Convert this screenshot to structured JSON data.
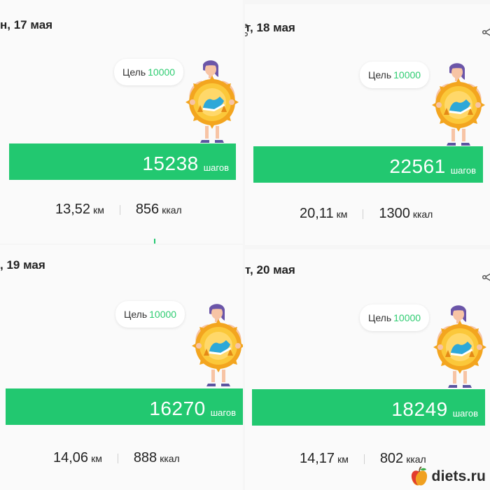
{
  "panels": [
    {
      "date": "н, 17 мая",
      "goal_label": "Цель",
      "goal_value": "10000",
      "steps": "15238",
      "steps_unit": "шагов",
      "distance": "13,52",
      "distance_unit": "км",
      "calories": "856",
      "calories_unit": "ккал"
    },
    {
      "date": "т, 18 мая",
      "goal_label": "Цель",
      "goal_value": "10000",
      "steps": "22561",
      "steps_unit": "шагов",
      "distance": "20,11",
      "distance_unit": "км",
      "calories": "1300",
      "calories_unit": "ккал"
    },
    {
      "date": ", 19 мая",
      "goal_label": "Цель",
      "goal_value": "10000",
      "steps": "16270",
      "steps_unit": "шагов",
      "distance": "14,06",
      "distance_unit": "км",
      "calories": "888",
      "calories_unit": "ккал"
    },
    {
      "date": "т, 20 мая",
      "goal_label": "Цель",
      "goal_value": "10000",
      "steps": "18249",
      "steps_unit": "шагов",
      "distance": "14,17",
      "distance_unit": "км",
      "calories": "802",
      "calories_unit": "ккал"
    }
  ],
  "icons": {
    "share": "share-icon",
    "mascot": "step-goal-mascot",
    "apple": "apple-icon"
  },
  "colors": {
    "accent": "#22c870",
    "goal_number": "#2ecc71",
    "medal": "#f6a623"
  },
  "watermark": "diets.ru"
}
